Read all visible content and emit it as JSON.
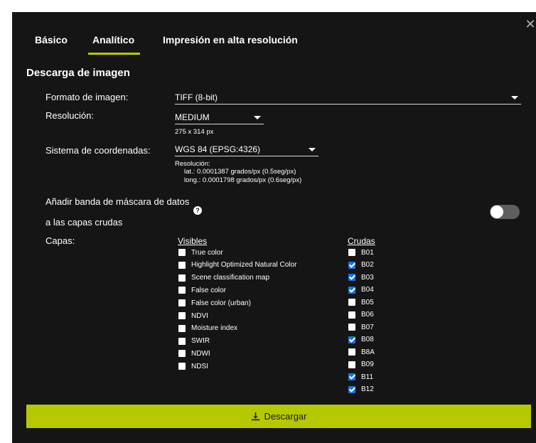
{
  "tabs": [
    {
      "label": "Básico"
    },
    {
      "label": "Analítico"
    },
    {
      "label": "Impresión en alta resolución"
    }
  ],
  "section_title": "Descarga de imagen",
  "format": {
    "label": "Formato de imagen:",
    "value": "TIFF (8-bit)"
  },
  "resolution": {
    "label": "Resolución:",
    "value": "MEDIUM",
    "dims": "275 x 314 px"
  },
  "crs": {
    "label": "Sistema de coordenadas:",
    "value": "WGS 84 (EPSG:4326)",
    "res_title": "Resolución:",
    "lat": "lat.: 0.0001387 grados/px (0.5seg/px)",
    "long": "long.: 0.0001798 grados/px (0.6seg/px)"
  },
  "mask": {
    "label_line1": "Añadir banda de máscara de datos",
    "label_line2": "a las capas crudas",
    "help": "?",
    "enabled": false
  },
  "layers": {
    "label": "Capas:",
    "visibles_header": "Visibles",
    "crudas_header": "Crudas",
    "visibles": [
      {
        "label": "True color",
        "checked": false
      },
      {
        "label": "Highlight Optimized Natural Color",
        "checked": false
      },
      {
        "label": "Scene classification map",
        "checked": false
      },
      {
        "label": "False color",
        "checked": false
      },
      {
        "label": "False color (urban)",
        "checked": false
      },
      {
        "label": "NDVI",
        "checked": false
      },
      {
        "label": "Moisture index",
        "checked": false
      },
      {
        "label": "SWIR",
        "checked": false
      },
      {
        "label": "NDWI",
        "checked": false
      },
      {
        "label": "NDSI",
        "checked": false
      }
    ],
    "crudas": [
      {
        "label": "B01",
        "checked": false
      },
      {
        "label": "B02",
        "checked": true
      },
      {
        "label": "B03",
        "checked": true
      },
      {
        "label": "B04",
        "checked": true
      },
      {
        "label": "B05",
        "checked": false
      },
      {
        "label": "B06",
        "checked": false
      },
      {
        "label": "B07",
        "checked": false
      },
      {
        "label": "B08",
        "checked": true
      },
      {
        "label": "B8A",
        "checked": false
      },
      {
        "label": "B09",
        "checked": false
      },
      {
        "label": "B11",
        "checked": true
      },
      {
        "label": "B12",
        "checked": true
      }
    ]
  },
  "download_label": "Descargar",
  "colors": {
    "accent": "#b6c800",
    "panel": "#151515",
    "checkbox_checked": "#1a73e8"
  }
}
